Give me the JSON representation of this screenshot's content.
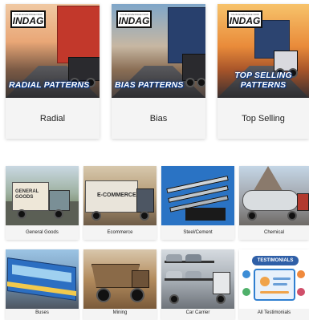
{
  "patterns": [
    {
      "brand_tag": "YOUR ADVANTAGE NOW",
      "brand": "INDAG",
      "caption": "RADIAL PATTERNS",
      "label": "Radial"
    },
    {
      "brand_tag": "YOUR ADVANTAGE NOW",
      "brand": "INDAG",
      "caption": "BIAS PATTERNS",
      "label": "Bias"
    },
    {
      "brand_tag": "YOUR ADVANTAGE NOW",
      "brand": "INDAG",
      "caption": "TOP SELLING PATTERNS",
      "label": "Top Selling"
    }
  ],
  "applications": [
    {
      "label": "General Goods",
      "image_text": "GENERAL GOODS"
    },
    {
      "label": "Ecommerce",
      "image_text": "E-COMMERCE"
    },
    {
      "label": "Steel/Cement"
    },
    {
      "label": "Chemical"
    },
    {
      "label": "Buses"
    },
    {
      "label": "Mining"
    },
    {
      "label": "Car Carrier"
    },
    {
      "label": "All Testimonials",
      "image_text": "TESTIMONIALS"
    }
  ],
  "colors": {
    "caption_outline": "#0a3a8a",
    "card_background": "#f4f4f4",
    "testimonial_accent": "#2f5fa7"
  }
}
